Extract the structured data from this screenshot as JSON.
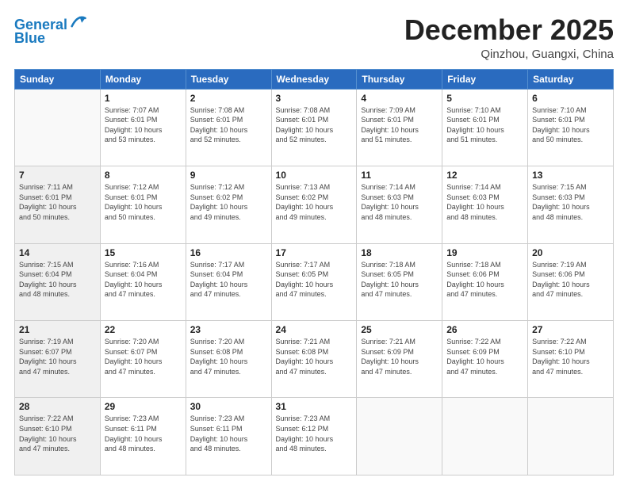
{
  "header": {
    "logo_line1": "General",
    "logo_line2": "Blue",
    "month": "December 2025",
    "location": "Qinzhou, Guangxi, China"
  },
  "days_of_week": [
    "Sunday",
    "Monday",
    "Tuesday",
    "Wednesday",
    "Thursday",
    "Friday",
    "Saturday"
  ],
  "weeks": [
    [
      {
        "day": "",
        "info": "",
        "empty": true
      },
      {
        "day": "1",
        "info": "Sunrise: 7:07 AM\nSunset: 6:01 PM\nDaylight: 10 hours\nand 53 minutes."
      },
      {
        "day": "2",
        "info": "Sunrise: 7:08 AM\nSunset: 6:01 PM\nDaylight: 10 hours\nand 52 minutes."
      },
      {
        "day": "3",
        "info": "Sunrise: 7:08 AM\nSunset: 6:01 PM\nDaylight: 10 hours\nand 52 minutes."
      },
      {
        "day": "4",
        "info": "Sunrise: 7:09 AM\nSunset: 6:01 PM\nDaylight: 10 hours\nand 51 minutes."
      },
      {
        "day": "5",
        "info": "Sunrise: 7:10 AM\nSunset: 6:01 PM\nDaylight: 10 hours\nand 51 minutes."
      },
      {
        "day": "6",
        "info": "Sunrise: 7:10 AM\nSunset: 6:01 PM\nDaylight: 10 hours\nand 50 minutes."
      }
    ],
    [
      {
        "day": "7",
        "info": "Sunrise: 7:11 AM\nSunset: 6:01 PM\nDaylight: 10 hours\nand 50 minutes.",
        "shaded": true
      },
      {
        "day": "8",
        "info": "Sunrise: 7:12 AM\nSunset: 6:01 PM\nDaylight: 10 hours\nand 50 minutes."
      },
      {
        "day": "9",
        "info": "Sunrise: 7:12 AM\nSunset: 6:02 PM\nDaylight: 10 hours\nand 49 minutes."
      },
      {
        "day": "10",
        "info": "Sunrise: 7:13 AM\nSunset: 6:02 PM\nDaylight: 10 hours\nand 49 minutes."
      },
      {
        "day": "11",
        "info": "Sunrise: 7:14 AM\nSunset: 6:03 PM\nDaylight: 10 hours\nand 48 minutes."
      },
      {
        "day": "12",
        "info": "Sunrise: 7:14 AM\nSunset: 6:03 PM\nDaylight: 10 hours\nand 48 minutes."
      },
      {
        "day": "13",
        "info": "Sunrise: 7:15 AM\nSunset: 6:03 PM\nDaylight: 10 hours\nand 48 minutes."
      }
    ],
    [
      {
        "day": "14",
        "info": "Sunrise: 7:15 AM\nSunset: 6:04 PM\nDaylight: 10 hours\nand 48 minutes.",
        "shaded": true
      },
      {
        "day": "15",
        "info": "Sunrise: 7:16 AM\nSunset: 6:04 PM\nDaylight: 10 hours\nand 47 minutes."
      },
      {
        "day": "16",
        "info": "Sunrise: 7:17 AM\nSunset: 6:04 PM\nDaylight: 10 hours\nand 47 minutes."
      },
      {
        "day": "17",
        "info": "Sunrise: 7:17 AM\nSunset: 6:05 PM\nDaylight: 10 hours\nand 47 minutes."
      },
      {
        "day": "18",
        "info": "Sunrise: 7:18 AM\nSunset: 6:05 PM\nDaylight: 10 hours\nand 47 minutes."
      },
      {
        "day": "19",
        "info": "Sunrise: 7:18 AM\nSunset: 6:06 PM\nDaylight: 10 hours\nand 47 minutes."
      },
      {
        "day": "20",
        "info": "Sunrise: 7:19 AM\nSunset: 6:06 PM\nDaylight: 10 hours\nand 47 minutes."
      }
    ],
    [
      {
        "day": "21",
        "info": "Sunrise: 7:19 AM\nSunset: 6:07 PM\nDaylight: 10 hours\nand 47 minutes.",
        "shaded": true
      },
      {
        "day": "22",
        "info": "Sunrise: 7:20 AM\nSunset: 6:07 PM\nDaylight: 10 hours\nand 47 minutes."
      },
      {
        "day": "23",
        "info": "Sunrise: 7:20 AM\nSunset: 6:08 PM\nDaylight: 10 hours\nand 47 minutes."
      },
      {
        "day": "24",
        "info": "Sunrise: 7:21 AM\nSunset: 6:08 PM\nDaylight: 10 hours\nand 47 minutes."
      },
      {
        "day": "25",
        "info": "Sunrise: 7:21 AM\nSunset: 6:09 PM\nDaylight: 10 hours\nand 47 minutes."
      },
      {
        "day": "26",
        "info": "Sunrise: 7:22 AM\nSunset: 6:09 PM\nDaylight: 10 hours\nand 47 minutes."
      },
      {
        "day": "27",
        "info": "Sunrise: 7:22 AM\nSunset: 6:10 PM\nDaylight: 10 hours\nand 47 minutes."
      }
    ],
    [
      {
        "day": "28",
        "info": "Sunrise: 7:22 AM\nSunset: 6:10 PM\nDaylight: 10 hours\nand 47 minutes.",
        "shaded": true
      },
      {
        "day": "29",
        "info": "Sunrise: 7:23 AM\nSunset: 6:11 PM\nDaylight: 10 hours\nand 48 minutes."
      },
      {
        "day": "30",
        "info": "Sunrise: 7:23 AM\nSunset: 6:11 PM\nDaylight: 10 hours\nand 48 minutes."
      },
      {
        "day": "31",
        "info": "Sunrise: 7:23 AM\nSunset: 6:12 PM\nDaylight: 10 hours\nand 48 minutes."
      },
      {
        "day": "",
        "info": "",
        "empty": true
      },
      {
        "day": "",
        "info": "",
        "empty": true
      },
      {
        "day": "",
        "info": "",
        "empty": true
      }
    ]
  ]
}
